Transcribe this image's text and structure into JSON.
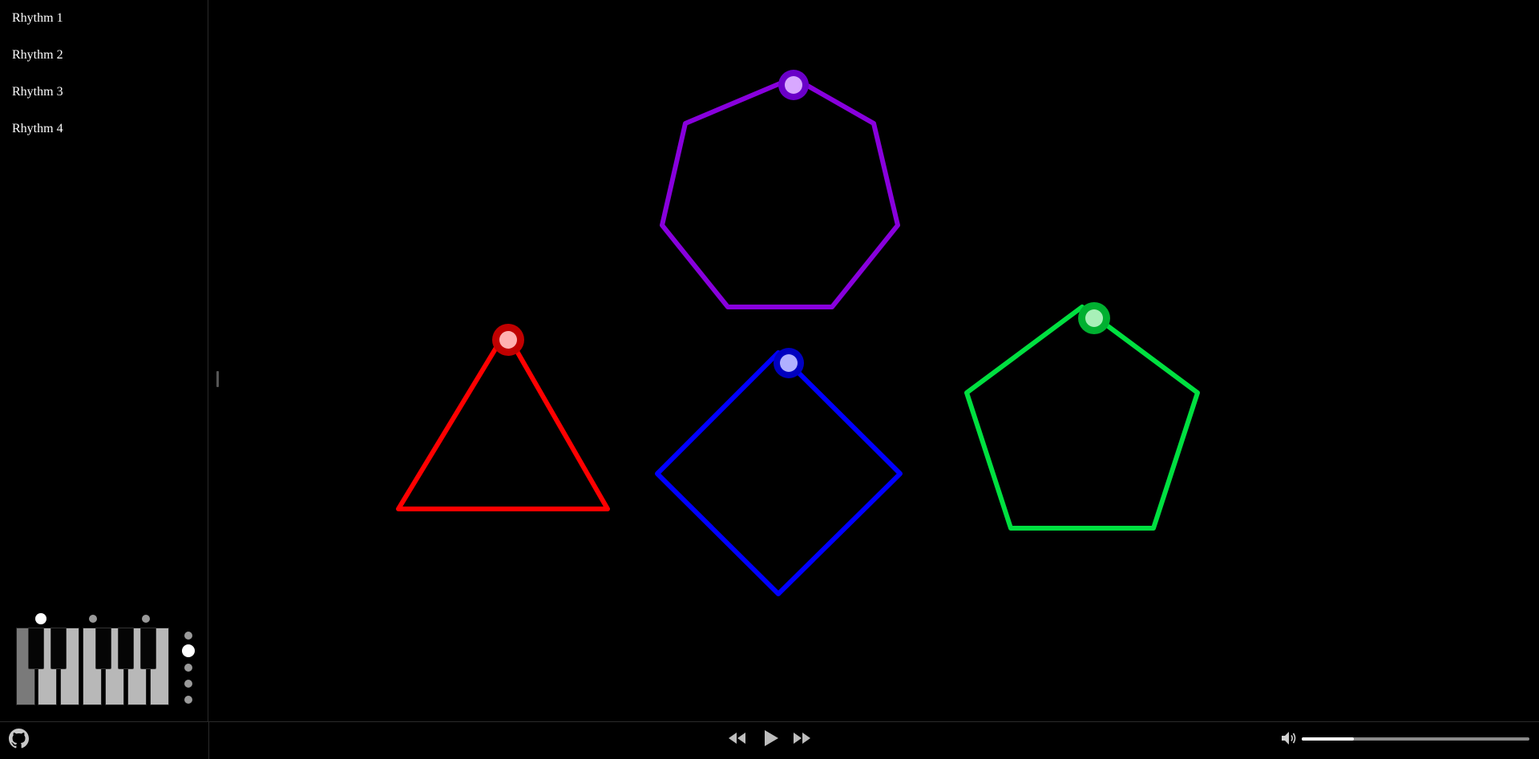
{
  "sidebar": {
    "items": [
      {
        "label": "Rhythm 1"
      },
      {
        "label": "Rhythm 2"
      },
      {
        "label": "Rhythm 3"
      },
      {
        "label": "Rhythm 4"
      }
    ]
  },
  "shapes": [
    {
      "name": "triangle",
      "sides": 3,
      "color": "#ff0000"
    },
    {
      "name": "square",
      "sides": 4,
      "color": "#0000ff"
    },
    {
      "name": "pentagon",
      "sides": 5,
      "color": "#00e040"
    },
    {
      "name": "heptagon",
      "sides": 7,
      "color": "#8800dd"
    }
  ],
  "piano": {
    "white_keys": 7,
    "selected_octave_index": 1,
    "octave_options": 5,
    "active_key_marker": 0
  },
  "controls": {
    "rewind_icon": "rewind-icon",
    "play_icon": "play-icon",
    "fast_forward_icon": "fast-forward-icon",
    "volume_icon": "speaker-icon",
    "github_icon": "github-icon",
    "volume": 0.23
  }
}
